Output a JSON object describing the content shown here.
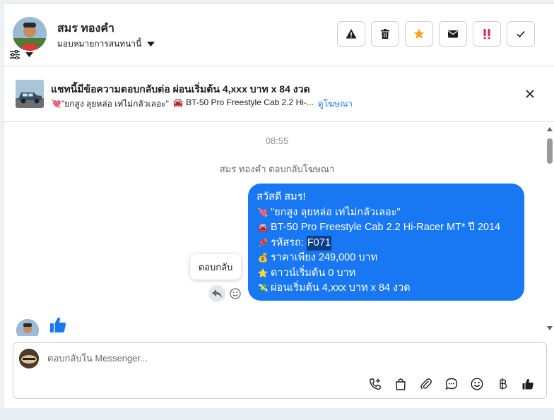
{
  "header": {
    "contact_name": "สมร ทองคำ",
    "assign_label": "มอบหมายการสนทนานี้",
    "actions": [
      {
        "name": "report-button",
        "icon": "warning-icon"
      },
      {
        "name": "delete-button",
        "icon": "trash-icon"
      },
      {
        "name": "star-button",
        "icon": "star-icon",
        "color": "#f5a623"
      },
      {
        "name": "mark-unread-button",
        "icon": "envelope-icon"
      },
      {
        "name": "follow-up-button",
        "icon": "double-exclamation-icon",
        "color": "#e41e3f"
      },
      {
        "name": "mark-done-button",
        "icon": "check-icon"
      }
    ]
  },
  "ad": {
    "title": "แชทนี้มีข้อความตอบกลับต่อ ผ่อนเริ่มต้น 4,xxx บาท x 84 งวด",
    "subtitle_quote": "💘\"ยกสูง ลุยหล่อ เท่ไม่กลัวเลอะ\"",
    "subtitle_car": "🚘 BT-50 Pro Freestyle Cab 2.2 Hi-...",
    "link": "ดูโฆษณา"
  },
  "conversation": {
    "time": "08:55",
    "system_note": "สมร ทองคำ ตอบกลับโฆษณา",
    "message": {
      "greeting": "สวัสดี สมร!",
      "lines": [
        {
          "emoji": "💘",
          "text": "\"ยกสูง ลุยหล่อ เท่ไม่กลัวเลอะ\""
        },
        {
          "emoji": "🚘",
          "text": "BT-50 Pro Freestyle Cab 2.2 Hi-Racer MT* ปี 2014"
        },
        {
          "emoji": "📌",
          "text": "รหัสรถ: ",
          "highlight": "F071"
        },
        {
          "emoji": "💰",
          "text": "ราคาเพียง 249,000 บาท"
        },
        {
          "emoji": "⭐",
          "text": "ดาวน์เริ่มต้น 0 บาท"
        },
        {
          "emoji": "💸",
          "text": "ผ่อนเริ่มต้น 4,xxx บาท x 84 งวด"
        }
      ]
    },
    "tooltip": "ตอบกลับ"
  },
  "composer": {
    "placeholder": "ตอบกลับใน Messenger..."
  },
  "colors": {
    "accent": "#1877f2",
    "like": "#1877f2"
  }
}
